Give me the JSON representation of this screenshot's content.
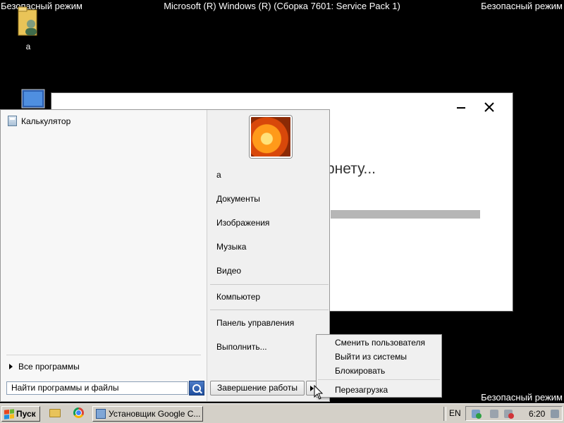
{
  "watermarks": {
    "top_left": "Безопасный режим",
    "top_right": "Безопасный режим",
    "top_center": "Microsoft (R) Windows (R) (Сборка 7601: Service Pack 1)",
    "bottom_right": "Безопасный режим"
  },
  "desktop": {
    "user_folder_label": "a"
  },
  "installer": {
    "status_text": "рнету...",
    "progress": 0
  },
  "start_menu": {
    "pinned": [
      {
        "label": "Калькулятор",
        "icon": "calculator-icon"
      }
    ],
    "all_programs": "Все программы",
    "search_placeholder": "Найти программы и файлы",
    "user_name": "a",
    "right_items": {
      "documents": "Документы",
      "images": "Изображения",
      "music": "Музыка",
      "video": "Видео",
      "computer": "Компьютер",
      "control_panel": "Панель управления",
      "run": "Выполнить..."
    },
    "shutdown_label": "Завершение работы"
  },
  "shutdown_submenu": {
    "switch_user": "Сменить пользователя",
    "log_off": "Выйти из системы",
    "lock": "Блокировать",
    "restart": "Перезагрузка"
  },
  "taskbar": {
    "start_label": "Пуск",
    "task_button": "Установщик Google C...",
    "language": "EN",
    "clock": "6:20"
  },
  "colors": {
    "desktop": "#000000",
    "taskbar": "#d4d0c8",
    "start_menu": "#f0f0f0"
  }
}
